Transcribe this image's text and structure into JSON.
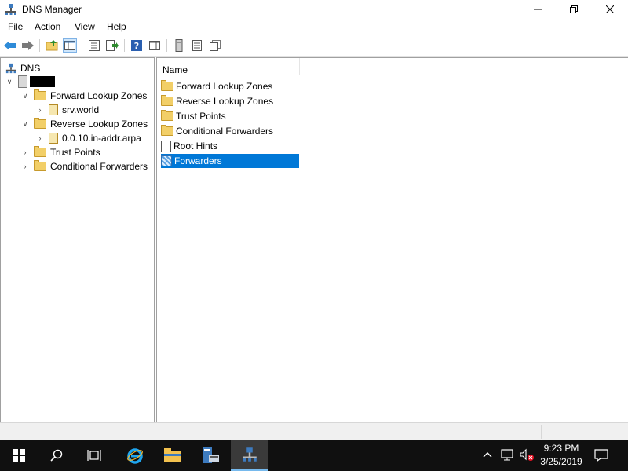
{
  "window": {
    "title": "DNS Manager"
  },
  "menu": [
    "File",
    "Action",
    "View",
    "Help"
  ],
  "tree": {
    "root": "DNS",
    "items": [
      {
        "label": "Forward Lookup Zones"
      },
      {
        "label": "srv.world"
      },
      {
        "label": "Reverse Lookup Zones"
      },
      {
        "label": "0.0.10.in-addr.arpa"
      },
      {
        "label": "Trust Points"
      },
      {
        "label": "Conditional Forwarders"
      }
    ]
  },
  "list": {
    "column": "Name",
    "items": [
      {
        "label": "Forward Lookup Zones"
      },
      {
        "label": "Reverse Lookup Zones"
      },
      {
        "label": "Trust Points"
      },
      {
        "label": "Conditional Forwarders"
      },
      {
        "label": "Root Hints"
      },
      {
        "label": "Forwarders"
      }
    ],
    "selected": "Forwarders"
  },
  "taskbar": {
    "time": "9:23 PM",
    "date": "3/25/2019"
  },
  "colors": {
    "selection": "#0078d7",
    "taskbar": "#101010"
  }
}
